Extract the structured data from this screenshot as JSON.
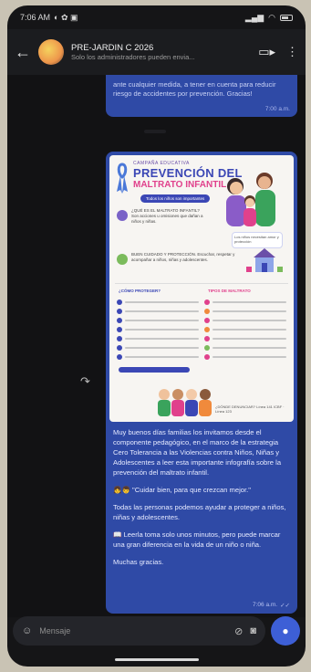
{
  "status_bar": {
    "time": "7:06 AM"
  },
  "header": {
    "group_name": "PRE-JARDIN C 2026",
    "subtitle": "Solo los administradores pueden envia..."
  },
  "messages": [
    {
      "type": "text",
      "text": "ante cualquier medida, a tener en cuenta para reducir riesgo de accidentes por prevención. Gracias!",
      "time": "7:00 a.m."
    },
    {
      "type": "image_with_caption",
      "poster": {
        "kicker": "CAMPAÑA EDUCATIVA",
        "title_line1": "PREVENCIÓN DEL",
        "title_line2": "MALTRATO INFANTIL",
        "tag": "Todos los niños son importantes",
        "block1": "¿QUÉ ES EL MALTRATO INFANTIL? Son acciones u omisiones que dañan a niños y niñas.",
        "block2": "BUEN CUIDADO Y PROTECCIÓN. Escuchar, respetar y acompañar a niños, niñas y adolescentes.",
        "note": "Los niños necesitan amor y protección",
        "col_left_head": "¿CÓMO PROTEGER?",
        "col_right_head": "TIPOS DE MALTRATO",
        "footer": "¿DÓNDE DENUNCIAR? Línea 141 ICBF · Línea 123"
      },
      "caption": [
        "Muy buenos días familias los invitamos desde el componente pedagógico, en el marco de la estrategia Cero Tolerancia a las Violencias contra Niños, Niñas y Adolescentes a leer esta importante infografía sobre la prevención del maltrato infantil.",
        "👧👦 \"Cuidar bien, para que crezcan mejor.\"",
        "Todas las personas podemos ayudar a proteger a niños, niñas y adolescentes.",
        "📖 Leerla toma solo unos minutos, pero puede marcar una gran diferencia en la vida de un niño o niña.",
        "Muchas gracias."
      ],
      "time": "7:06 a.m."
    }
  ],
  "composer": {
    "placeholder": "Mensaje"
  },
  "icons": {
    "back": "arrow-left-icon",
    "video": "video-call-icon",
    "more": "more-vert-icon",
    "emoji": "emoji-icon",
    "attach": "attachment-icon",
    "camera": "camera-icon",
    "mic": "mic-icon",
    "forward": "forward-icon"
  },
  "colors": {
    "bubble": "#2f4aa6",
    "accent": "#3d5fd6",
    "poster_blue": "#3b47b5",
    "poster_pink": "#e0418c"
  }
}
